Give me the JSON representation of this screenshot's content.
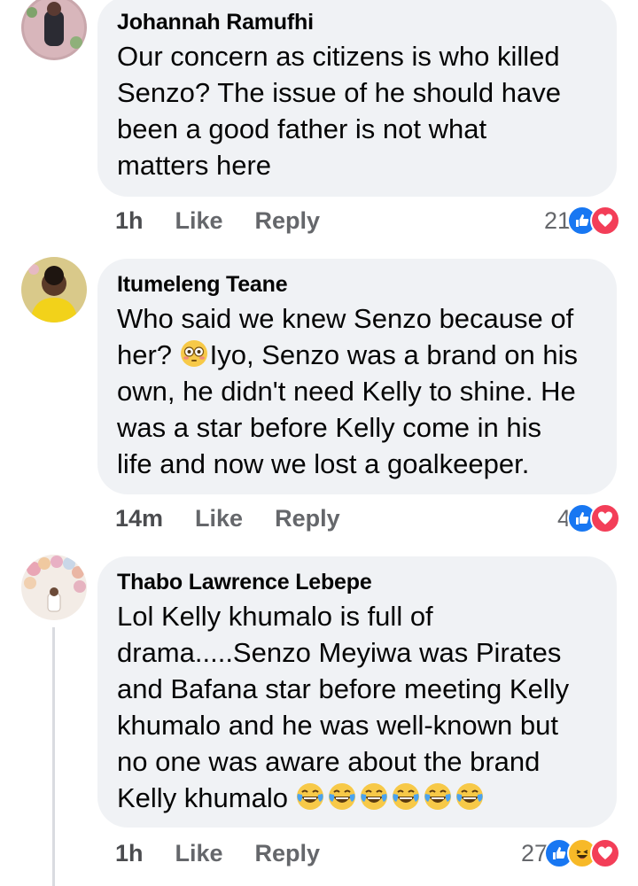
{
  "comments": [
    {
      "author": "Johannah Ramufhi",
      "lines": [
        "Our concern as citizens is who killed",
        "Senzo?  The issue of he should have",
        "been a good father is not what",
        "matters here"
      ],
      "time": "1h",
      "like_label": "Like",
      "reply_label": "Reply",
      "reaction_count": "21",
      "reactions": [
        "like-icon",
        "love-icon"
      ]
    },
    {
      "author": "Itumeleng Teane",
      "lines": [
        "Who said we knew Senzo because of",
        "Iyo, Senzo was a brand on his",
        "own, he didn't need Kelly to shine. He",
        "was a star before Kelly come in his",
        "life and now we lost a goalkeeper."
      ],
      "line2_prefix": "her?",
      "time": "14m",
      "like_label": "Like",
      "reply_label": "Reply",
      "reaction_count": "4",
      "reactions": [
        "like-icon",
        "love-icon"
      ]
    },
    {
      "author": "Thabo Lawrence Lebepe",
      "lines": [
        "Lol Kelly khumalo is full of",
        "drama.....Senzo Meyiwa was Pirates",
        "and Bafana star before meeting Kelly",
        "khumalo and he was well-known but",
        "no one was aware about the brand",
        "Kelly khumalo"
      ],
      "time": "1h",
      "like_label": "Like",
      "reply_label": "Reply",
      "reaction_count": "27",
      "reactions": [
        "like-icon",
        "haha-icon",
        "love-icon"
      ]
    }
  ],
  "colors": {
    "bubble": "#f0f2f5",
    "like_blue": "#1877f2",
    "love_red": "#f33e58",
    "haha_yellow": "#f7b928",
    "muted": "#65676b"
  }
}
